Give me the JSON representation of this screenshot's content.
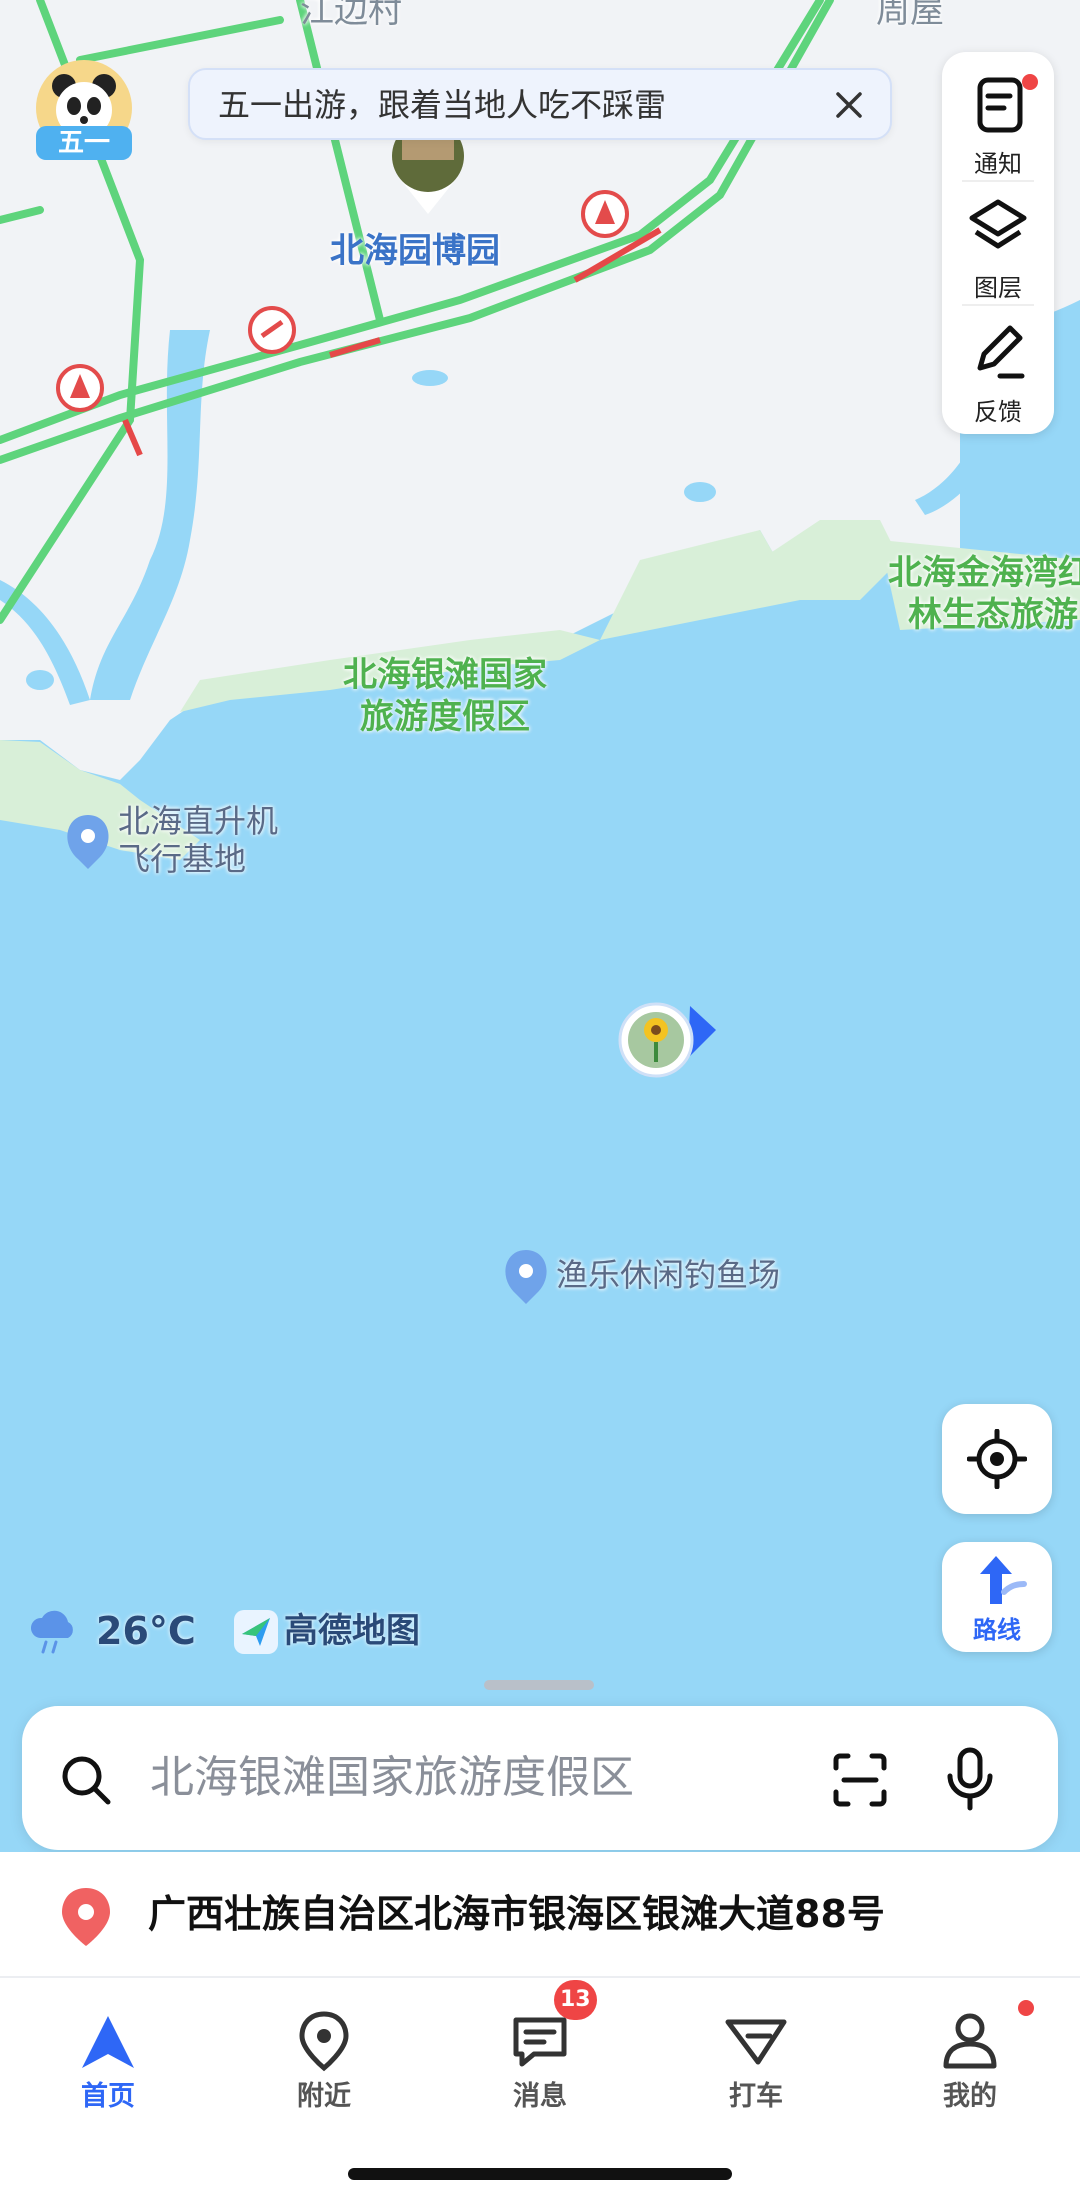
{
  "map": {
    "labels": {
      "top_village": "江边村",
      "top_right": "周屋",
      "garden_expo": "北海园博园",
      "resort_line1": "北海银滩国家",
      "resort_line2": "旅游度假区",
      "jinhaiwan_line1": "北海金海湾红",
      "jinhaiwan_line2": "林生态旅游",
      "heliport_line1": "北海直升机",
      "heliport_line2": "飞行基地",
      "fishing": "渔乐休闲钓鱼场"
    },
    "colors": {
      "sea": "#96d7f7",
      "land": "#f1f3f6",
      "green_land": "#d8efd8",
      "road": "#5ed47c"
    }
  },
  "banner": {
    "text": "五一出游，跟着当地人吃不踩雷",
    "icon": "close-icon"
  },
  "badge_topleft": {
    "text": "五一"
  },
  "side_panel": {
    "items": [
      {
        "label": "通知",
        "icon": "notification-icon"
      },
      {
        "label": "图层",
        "icon": "layers-icon"
      },
      {
        "label": "反馈",
        "icon": "feedback-icon"
      }
    ]
  },
  "locate_button": {
    "icon": "locate-icon"
  },
  "route_button": {
    "label": "路线",
    "icon": "route-arrow-icon"
  },
  "weather": {
    "temp": "26°C",
    "icon": "rain-cloud-icon"
  },
  "brand": {
    "name": "高德地图"
  },
  "search": {
    "placeholder": "北海银滩国家旅游度假区",
    "icons": [
      "search-icon",
      "scan-icon",
      "microphone-icon"
    ]
  },
  "address": {
    "text": "广西壮族自治区北海市银海区银滩大道88号",
    "icon": "location-pin-icon"
  },
  "tabs": [
    {
      "label": "首页",
      "icon": "navigation-arrow-icon",
      "active": true
    },
    {
      "label": "附近",
      "icon": "nearby-pin-icon"
    },
    {
      "label": "消息",
      "icon": "message-icon",
      "badge": "13"
    },
    {
      "label": "打车",
      "icon": "taxi-icon"
    },
    {
      "label": "我的",
      "icon": "user-icon",
      "dot": true
    }
  ],
  "accent": "#2e67f6"
}
